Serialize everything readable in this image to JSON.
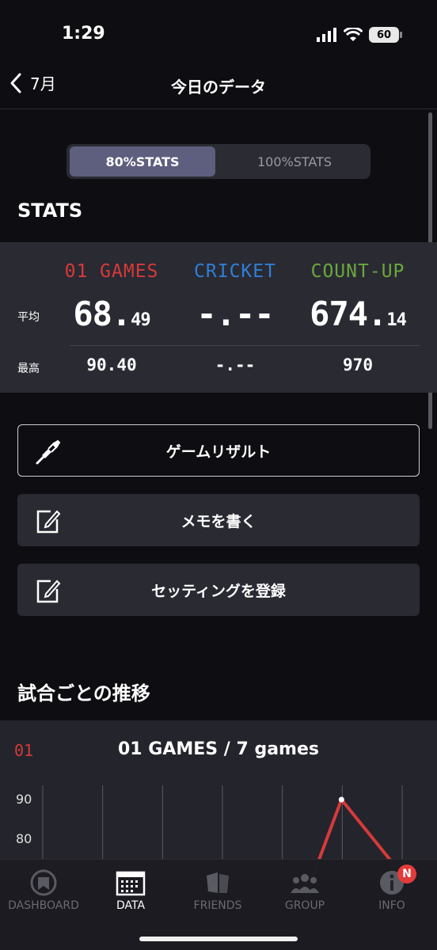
{
  "status": {
    "time": "1:29",
    "battery": "60"
  },
  "nav": {
    "back_label": "7月",
    "title": "今日のデータ"
  },
  "segment": {
    "option1": "80%STATS",
    "option2": "100%STATS",
    "selected": "80%STATS"
  },
  "stats": {
    "title": "STATS",
    "columns": [
      {
        "name": "01 GAMES",
        "color": "#d63a3a",
        "avg_int": "68.",
        "avg_dec": "49",
        "max": "90.40"
      },
      {
        "name": "CRICKET",
        "color": "#2f7fd6",
        "avg_int": "-.--",
        "avg_dec": "",
        "max": "-.--"
      },
      {
        "name": "COUNT-UP",
        "color": "#6aa83a",
        "avg_int": "674.",
        "avg_dec": "14",
        "max": "970"
      }
    ],
    "avg_label": "平均",
    "max_label": "最高"
  },
  "actions": {
    "game_result": "ゲームリザルト",
    "write_memo": "メモを書く",
    "register_setting": "セッティングを登録"
  },
  "trend": {
    "title": "試合ごとの推移",
    "badge": "01",
    "graph_title": "01 GAMES / 7 games",
    "y_ticks": [
      "90",
      "80"
    ]
  },
  "chart_data": {
    "type": "line",
    "title": "01 GAMES / 7 games",
    "yticks": [
      80,
      90
    ],
    "series": [
      {
        "values": [
          null,
          null,
          null,
          null,
          null,
          90,
          null
        ]
      }
    ],
    "color": "#d63a3a"
  },
  "tabs": [
    {
      "label": "DASHBOARD",
      "icon": "dashboard-icon",
      "active": false
    },
    {
      "label": "DATA",
      "icon": "calendar-icon",
      "active": true
    },
    {
      "label": "FRIENDS",
      "icon": "friends-icon",
      "active": false
    },
    {
      "label": "GROUP",
      "icon": "group-icon",
      "active": false
    },
    {
      "label": "INFO",
      "icon": "info-icon",
      "active": false,
      "badge": "N"
    }
  ]
}
